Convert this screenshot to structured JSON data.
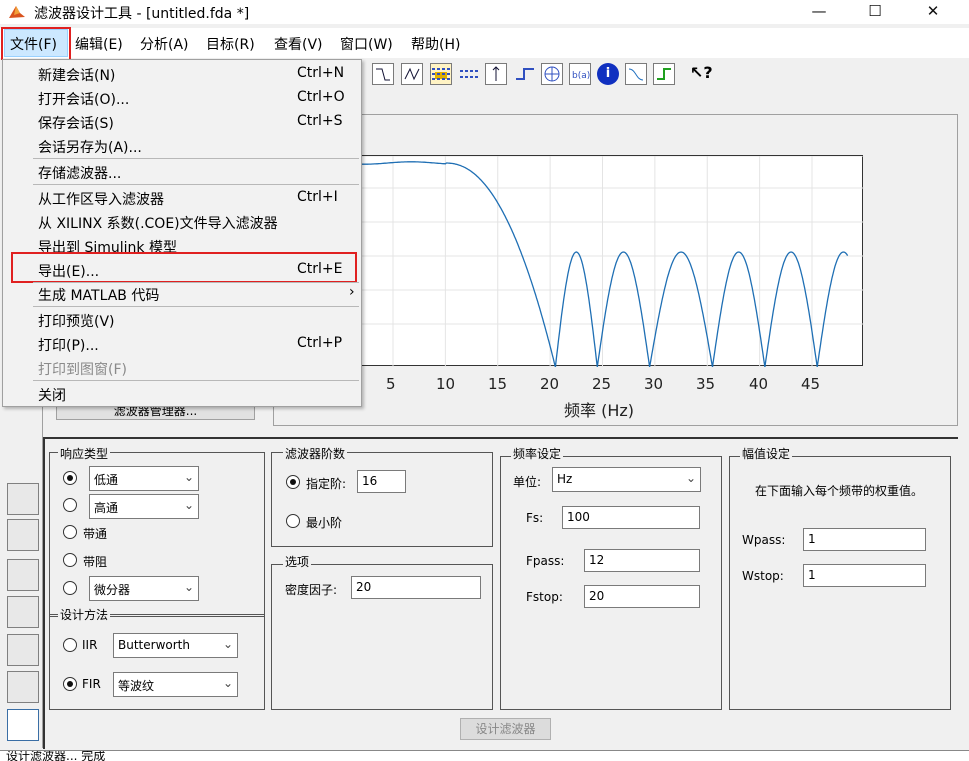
{
  "window": {
    "title": "滤波器设计工具 - [untitled.fda *]",
    "minimize": "—",
    "maximize": "☐",
    "close": "✕"
  },
  "menubar": [
    "文件(F)",
    "编辑(E)",
    "分析(A)",
    "目标(R)",
    "查看(V)",
    "窗口(W)",
    "帮助(H)"
  ],
  "file_menu": {
    "items": [
      {
        "label": "新建会话(N)",
        "shortcut": "Ctrl+N"
      },
      {
        "label": "打开会话(O)...",
        "shortcut": "Ctrl+O"
      },
      {
        "label": "保存会话(S)",
        "shortcut": "Ctrl+S"
      },
      {
        "label": "会话另存为(A)...",
        "shortcut": ""
      },
      {
        "label": "存储滤波器...",
        "shortcut": ""
      },
      {
        "label": "从工作区导入滤波器",
        "shortcut": "Ctrl+I"
      },
      {
        "label": "从 XILINX 系数(.COE)文件导入滤波器",
        "shortcut": ""
      },
      {
        "label": "导出到 Simulink 模型",
        "shortcut": ""
      },
      {
        "label": "导出(E)...",
        "shortcut": "Ctrl+E"
      },
      {
        "label": "生成 MATLAB 代码",
        "shortcut": "",
        "submenu": "›"
      },
      {
        "label": "打印预览(V)",
        "shortcut": ""
      },
      {
        "label": "打印(P)...",
        "shortcut": "Ctrl+P"
      },
      {
        "label": "打印到图窗(F)",
        "shortcut": ""
      },
      {
        "label": "关闭",
        "shortcut": ""
      }
    ]
  },
  "plot": {
    "xlabel": "频率 (Hz)",
    "xticks": [
      "5",
      "10",
      "15",
      "20",
      "25",
      "30",
      "35",
      "40",
      "45"
    ]
  },
  "chart_data": {
    "type": "line",
    "xlabel": "频率 (Hz)",
    "x_ticks": [
      5,
      10,
      15,
      20,
      25,
      30,
      35,
      40,
      45
    ],
    "passband_edge_hz": 12,
    "stopband_nulls_hz": [
      20.5,
      24.5,
      29.5,
      35.5,
      40.5,
      45.5
    ],
    "grid": true
  },
  "filter_manager_label": "滤波器管理器...",
  "response_type": {
    "title": "响应类型",
    "lowpass": "低通",
    "highpass": "高通",
    "bandpass": "带通",
    "bandstop": "带阻",
    "differentiator": "微分器"
  },
  "design_method": {
    "title": "设计方法",
    "iir": "IIR",
    "iir_value": "Butterworth",
    "fir": "FIR",
    "fir_value": "等波纹"
  },
  "filter_order": {
    "title": "滤波器阶数",
    "specify": "指定阶:",
    "specify_value": "16",
    "minimum": "最小阶"
  },
  "options": {
    "title": "选项",
    "density_label": "密度因子:",
    "density_value": "20"
  },
  "freq_spec": {
    "title": "频率设定",
    "units_label": "单位:",
    "units_value": "Hz",
    "fs_label": "Fs:",
    "fs_value": "100",
    "fpass_label": "Fpass:",
    "fpass_value": "12",
    "fstop_label": "Fstop:",
    "fstop_value": "20"
  },
  "mag_spec": {
    "title": "幅值设定",
    "desc": "在下面输入每个频带的权重值。",
    "wpass_label": "Wpass:",
    "wpass_value": "1",
    "wstop_label": "Wstop:",
    "wstop_value": "1"
  },
  "design_button": "设计滤波器",
  "status": "设计滤波器... 完成"
}
